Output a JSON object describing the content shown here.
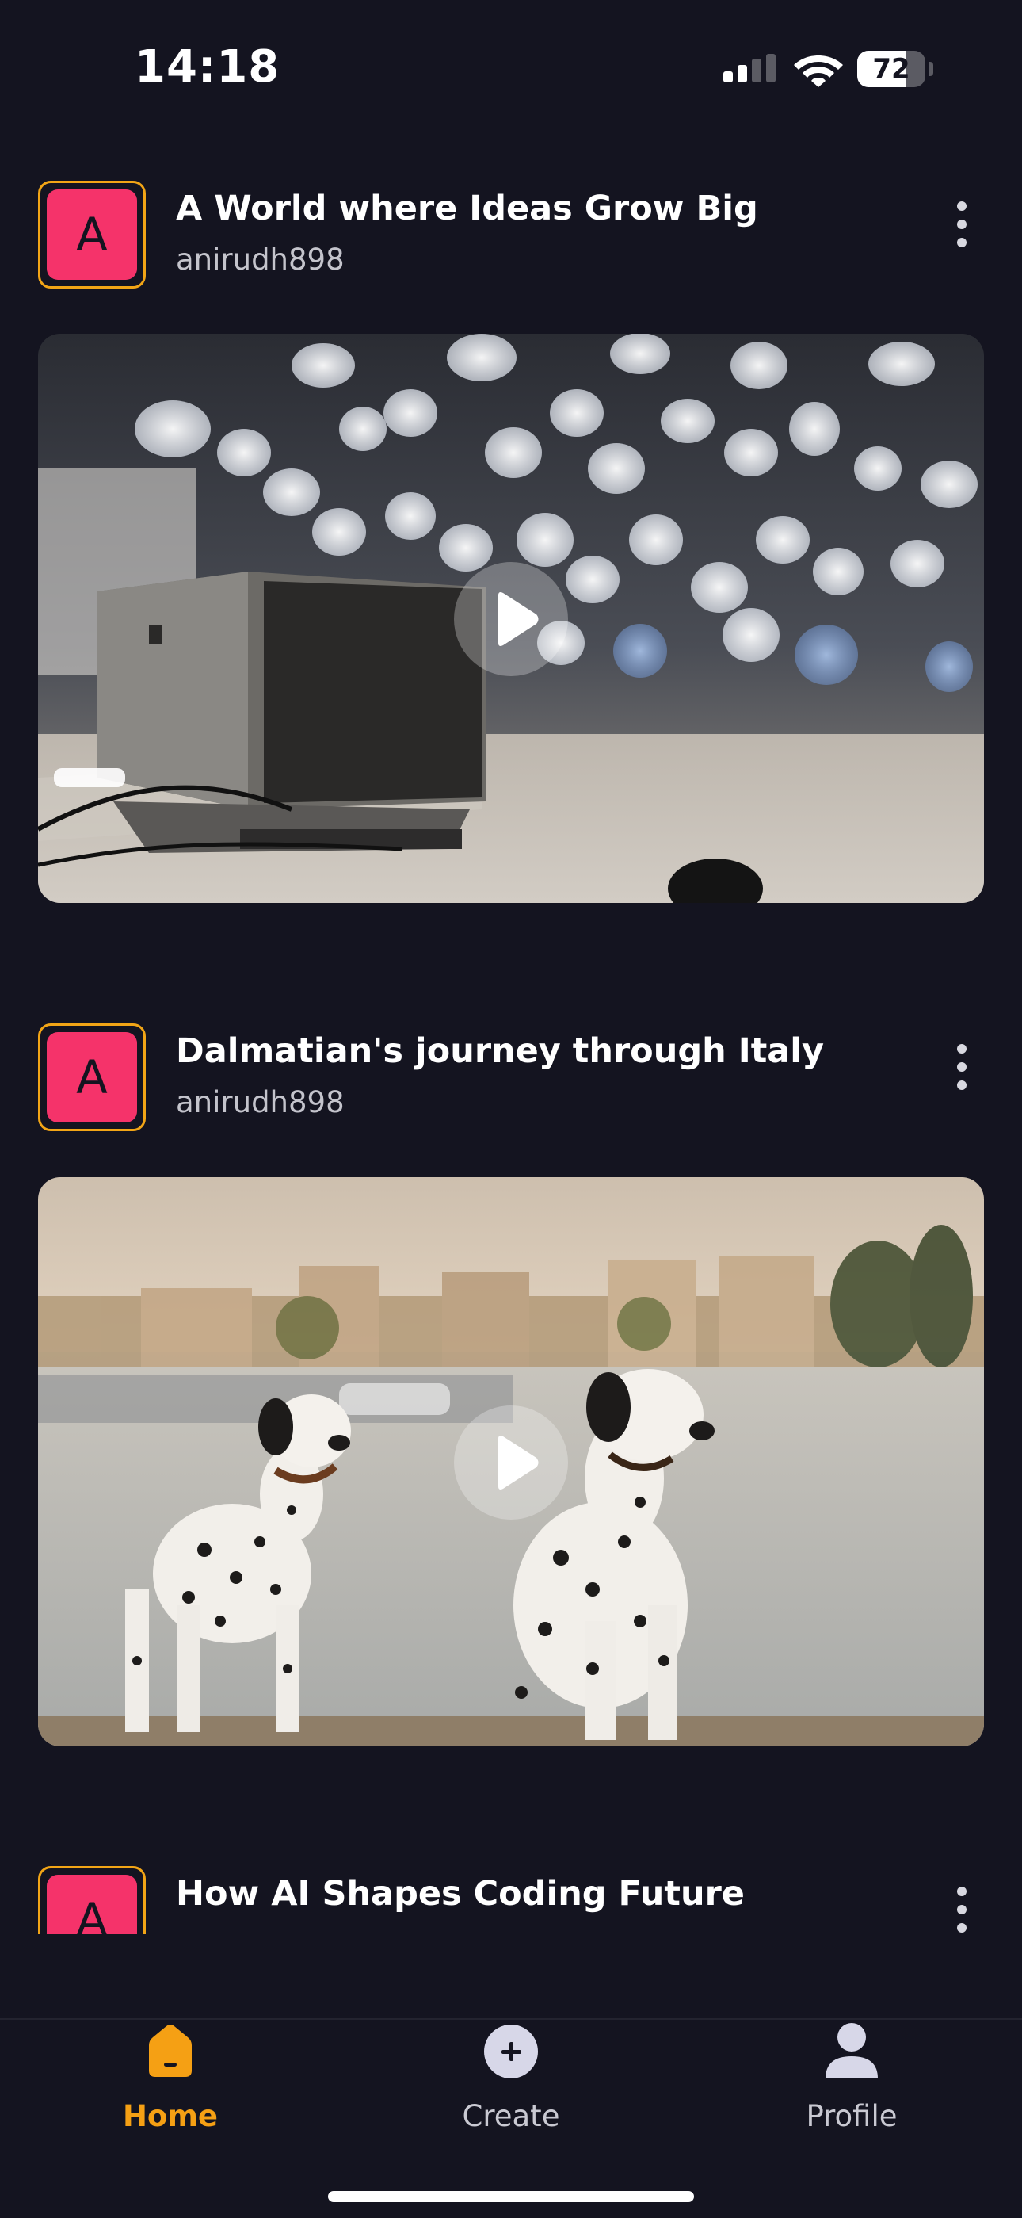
{
  "status_bar": {
    "time": "14:18",
    "battery_level": "72",
    "battery_fraction": 0.72
  },
  "posts": [
    {
      "avatar_letter": "A",
      "title": "A World where Ideas Grow Big",
      "author": "anirudh898",
      "thumbnail": "speaker-bokeh-video"
    },
    {
      "avatar_letter": "A",
      "title": "Dalmatian's journey through Italy",
      "author": "anirudh898",
      "thumbnail": "dalmatians-italy-video"
    },
    {
      "avatar_letter": "A",
      "title": "How AI Shapes Coding Future",
      "author": ""
    }
  ],
  "nav": {
    "items": [
      {
        "label": "Home",
        "icon": "home-icon",
        "active": true
      },
      {
        "label": "Create",
        "icon": "plus-circle-icon",
        "active": false
      },
      {
        "label": "Profile",
        "icon": "person-icon",
        "active": false
      }
    ]
  },
  "colors": {
    "background": "#141420",
    "accent": "#f5a014",
    "avatar": "#f5336a"
  }
}
